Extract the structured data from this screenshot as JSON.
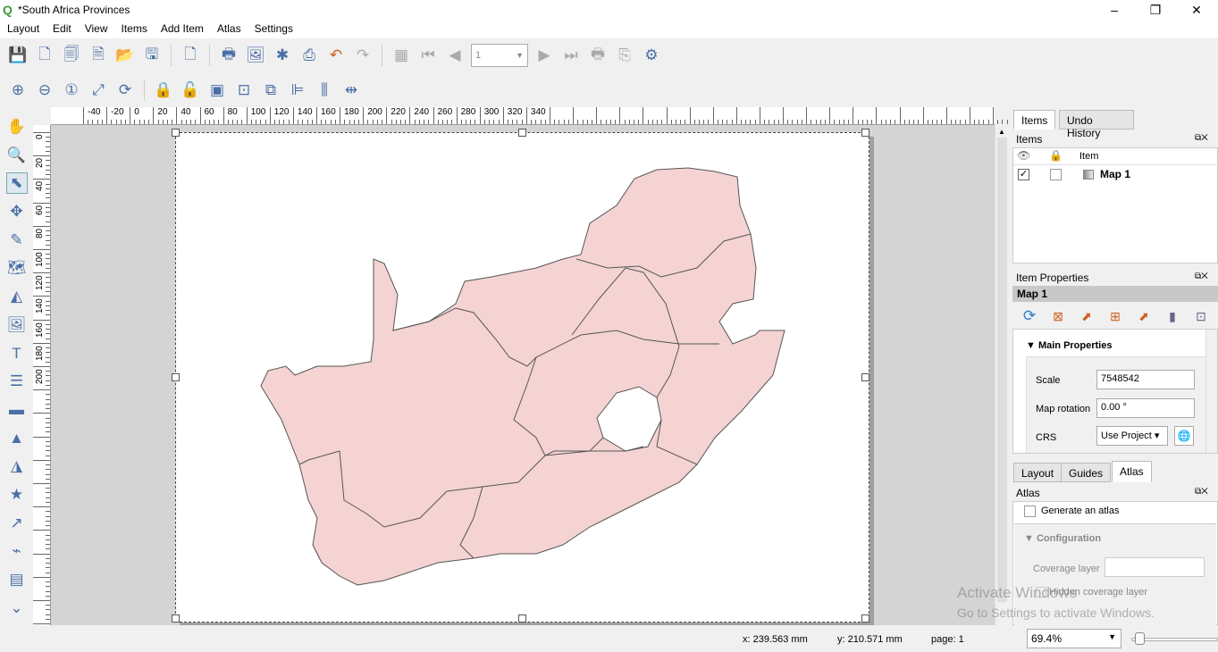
{
  "window": {
    "title": "*South Africa Provinces",
    "controls": [
      "–",
      "❐",
      "✕"
    ]
  },
  "menu": [
    "Layout",
    "Edit",
    "View",
    "Items",
    "Add Item",
    "Atlas",
    "Settings"
  ],
  "toolbar1": [
    "save-icon",
    "new-layout-icon",
    "duplicate-layout-icon",
    "layout-manager-icon",
    "open-folder-icon",
    "save-template-icon",
    "|",
    "add-pages-icon",
    "|",
    "print-icon",
    "export-image-icon",
    "export-svg-icon",
    "export-pdf-icon",
    "undo-icon",
    "redo-icon",
    "|",
    "atlas-preview-icon",
    "first-feature-icon",
    "previous-feature-icon"
  ],
  "toolbar1b": [
    "next-feature-icon",
    "last-feature-icon",
    "print-atlas-icon",
    "export-atlas-icon",
    "atlas-settings-icon"
  ],
  "atlas_page": "1",
  "toolbar2": [
    "zoom-in-icon",
    "zoom-out-icon",
    "zoom-100-icon",
    "zoom-full-icon",
    "refresh-icon",
    "|",
    "lock-items-icon",
    "unlock-items-icon",
    "group-icon",
    "ungroup-icon",
    "raise-items-icon",
    "align-left-icon",
    "distribute-icon",
    "resize-icon"
  ],
  "lefttools": [
    "pan-icon",
    "zoom-tool-icon",
    "select-move-icon",
    "move-content-icon",
    "edit-nodes-icon",
    "add-map-icon",
    "add-3d-map-icon",
    "add-picture-icon",
    "add-label-icon",
    "add-legend-icon",
    "add-scalebar-icon",
    "add-north-arrow-icon",
    "add-shape-icon",
    "add-marker-icon",
    "add-arrow-icon",
    "add-node-item-icon",
    "add-html-icon",
    "more-tools-icon"
  ],
  "ruler": {
    "h": [
      "-40",
      "-20",
      "0",
      "20",
      "40",
      "60",
      "80",
      "100",
      "120",
      "140",
      "160",
      "180",
      "200",
      "220",
      "240",
      "260",
      "280",
      "300",
      "320",
      "340"
    ],
    "v": [
      "0",
      "20",
      "40",
      "60",
      "80",
      "100",
      "120",
      "140",
      "160",
      "180",
      "200"
    ]
  },
  "map": {
    "fill": "#f5d3d3",
    "stroke": "#555555"
  },
  "panel": {
    "tabs": [
      "Items",
      "Undo History"
    ],
    "items_title": "Items",
    "items_header": "Item",
    "items": [
      {
        "name": "Map 1",
        "visible": true,
        "locked": false
      }
    ],
    "props_title": "Item Properties",
    "props_item": "Map 1",
    "main_props": "Main Properties",
    "scale_label": "Scale",
    "scale": "7548542",
    "rotation_label": "Map rotation",
    "rotation": "0.00 °",
    "crs_label": "CRS",
    "crs": "Use Project",
    "bottom_tabs": [
      "Layout",
      "Guides",
      "Atlas"
    ],
    "atlas_title": "Atlas",
    "generate_atlas": "Generate an atlas",
    "configuration": "Configuration",
    "coverage_layer": "Coverage layer",
    "hidden_coverage": "Hidden coverage layer"
  },
  "status": {
    "x": "x: 239.563 mm",
    "y": "y: 210.571 mm",
    "page": "page: 1",
    "zoom": "69.4%",
    "zoom_slider": 0.05
  },
  "watermark": {
    "line1": "Activate Windows",
    "line2": "Go to Settings to activate Windows."
  }
}
